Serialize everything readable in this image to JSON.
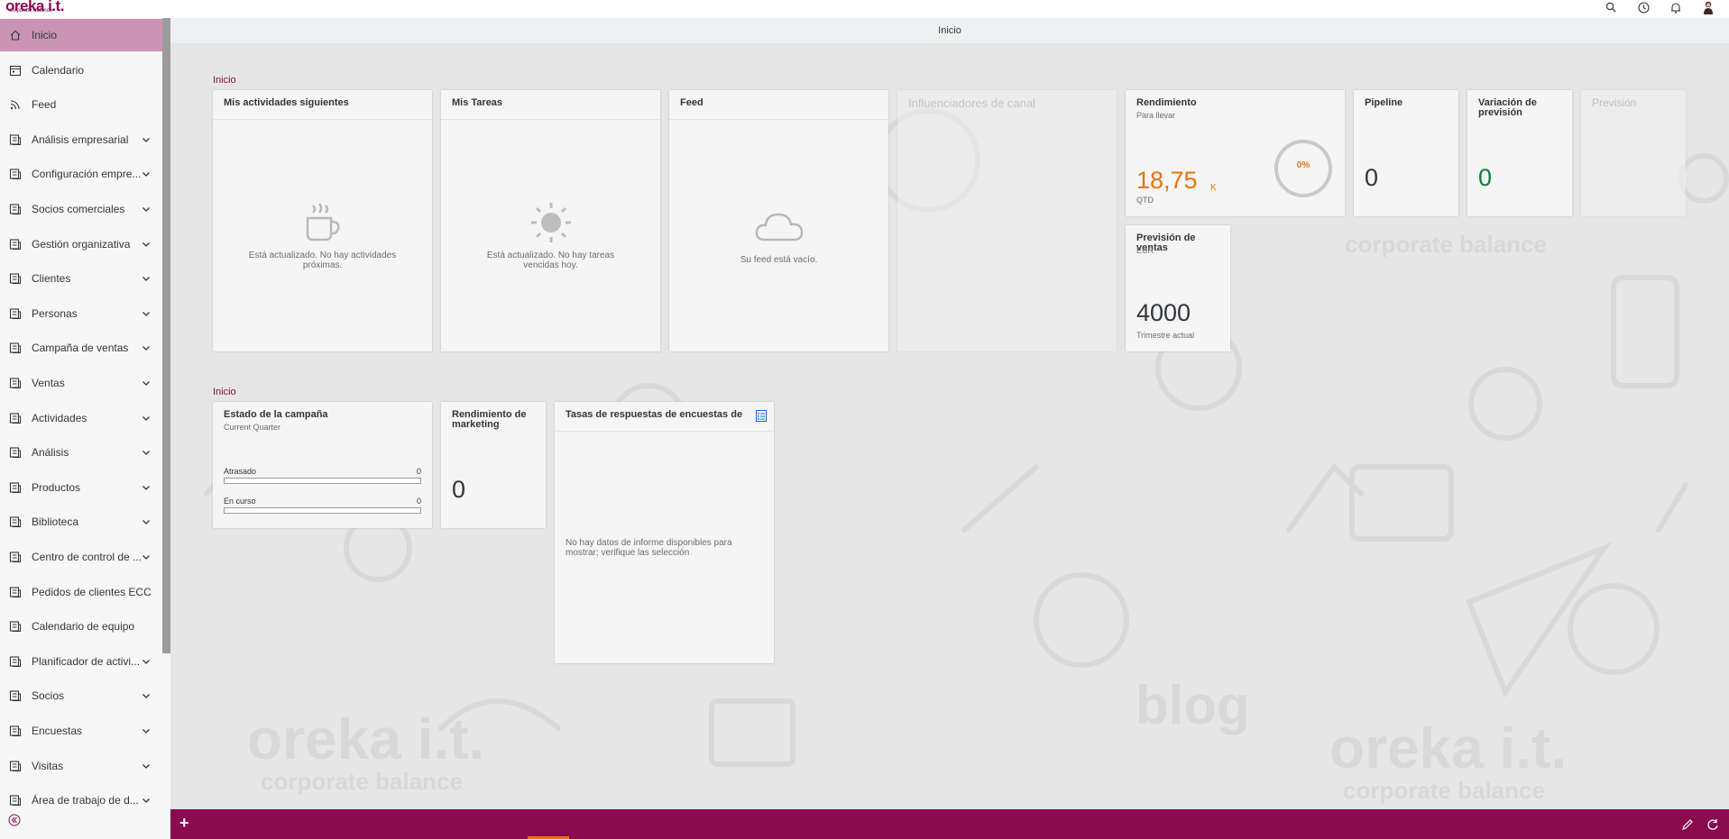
{
  "brand": {
    "logo_text": "oreka i.t.",
    "logo_sub": "corporate balance"
  },
  "shell": {
    "title": "Inicio"
  },
  "top_icons": [
    "search-icon",
    "clock-icon",
    "bell-icon",
    "user-avatar"
  ],
  "sidebar": {
    "items": [
      {
        "label": "Inicio",
        "icon": "home-icon",
        "expandable": false,
        "active": true
      },
      {
        "label": "Calendario",
        "icon": "calendar-icon",
        "expandable": false
      },
      {
        "label": "Feed",
        "icon": "feed-icon",
        "expandable": false
      },
      {
        "label": "Análisis empresarial",
        "icon": "business-analysis-icon",
        "expandable": true
      },
      {
        "label": "Configuración empre...",
        "icon": "config-icon",
        "expandable": true
      },
      {
        "label": "Socios comerciales",
        "icon": "partners-icon",
        "expandable": true
      },
      {
        "label": "Gestión organizativa",
        "icon": "org-icon",
        "expandable": true
      },
      {
        "label": "Clientes",
        "icon": "customers-icon",
        "expandable": true
      },
      {
        "label": "Personas",
        "icon": "person-icon",
        "expandable": true
      },
      {
        "label": "Campaña de ventas",
        "icon": "campaign-icon",
        "expandable": true
      },
      {
        "label": "Ventas",
        "icon": "sales-icon",
        "expandable": true
      },
      {
        "label": "Actividades",
        "icon": "activities-icon",
        "expandable": true
      },
      {
        "label": "Análisis",
        "icon": "analysis-icon",
        "expandable": true
      },
      {
        "label": "Productos",
        "icon": "products-icon",
        "expandable": true
      },
      {
        "label": "Biblioteca",
        "icon": "library-icon",
        "expandable": true
      },
      {
        "label": "Centro de control de ...",
        "icon": "control-center-icon",
        "expandable": true
      },
      {
        "label": "Pedidos de clientes ECC",
        "icon": "orders-icon",
        "expandable": false
      },
      {
        "label": "Calendario de equipo",
        "icon": "team-calendar-icon",
        "expandable": false
      },
      {
        "label": "Planificador de activi...",
        "icon": "planner-icon",
        "expandable": true
      },
      {
        "label": "Socios",
        "icon": "socios-icon",
        "expandable": true
      },
      {
        "label": "Encuestas",
        "icon": "survey-icon",
        "expandable": true
      },
      {
        "label": "Visitas",
        "icon": "visits-icon",
        "expandable": true
      },
      {
        "label": "Área de trabajo de d...",
        "icon": "workspace-icon",
        "expandable": true
      }
    ]
  },
  "groups": {
    "first_title": "Inicio",
    "second_title": "Inicio"
  },
  "tiles": {
    "activities": {
      "title": "Mis actividades siguientes",
      "empty": "Está actualizado. No hay actividades próximas."
    },
    "tasks": {
      "title": "Mis Tareas",
      "empty": "Está actualizado. No hay tareas vencidas hoy."
    },
    "feed": {
      "title": "Feed",
      "empty": "Su feed está vacío."
    },
    "influencers": {
      "title": "Influenciadores de canal"
    },
    "performance": {
      "title": "Rendimiento",
      "subtitle": "Para llevar",
      "value": "18,75",
      "unit": "K",
      "footer": "QTD",
      "ring_label": "0%",
      "ring_percent": 0
    },
    "pipeline": {
      "title": "Pipeline",
      "value": "0"
    },
    "forecast_variation": {
      "title": "Variación de previsión",
      "value": "0"
    },
    "forecast": {
      "title": "Previsión"
    },
    "sales_forecast": {
      "title": "Previsión de ventas",
      "subtitle": "EUR",
      "value": "4000",
      "footer": "Trimestre actual"
    },
    "campaign_status": {
      "title": "Estado de la campaña",
      "subtitle": "Current Quarter",
      "rows": [
        {
          "label": "Atrasado",
          "value": "0"
        },
        {
          "label": "En curso",
          "value": "0"
        }
      ]
    },
    "marketing": {
      "title": "Rendimiento de marketing",
      "value": "0"
    },
    "survey": {
      "title": "Tasas de respuestas de encuestas de satisf...",
      "empty": "No hay datos de informe disponibles para mostrar; verifique las selección"
    }
  },
  "colors": {
    "brand": "#8a0a4f",
    "active_nav": "#c993b3",
    "kpi_orange": "#e9730c",
    "kpi_green": "#107e3e"
  }
}
